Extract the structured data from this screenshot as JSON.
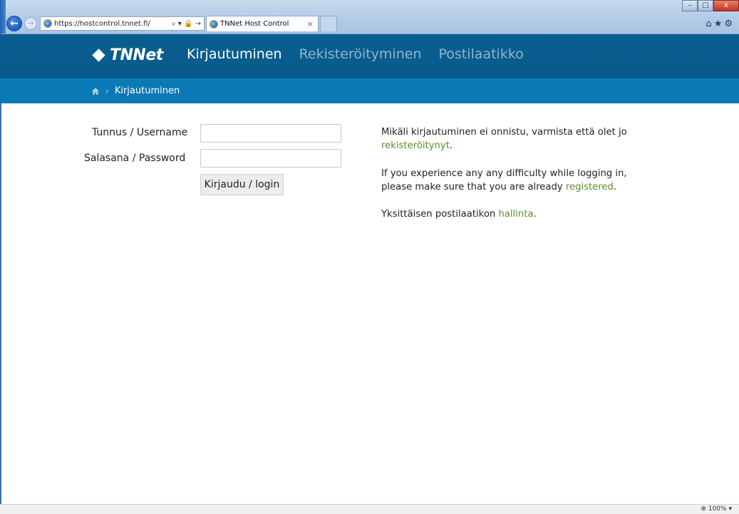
{
  "browser": {
    "url": "https://hostcontrol.tnnet.fi/",
    "address_controls": "⌕ ▾ 🔒 →",
    "tab_title": "TNNet Host Control",
    "tab_close": "×",
    "zoom": "100%"
  },
  "site": {
    "logo_text": "TNNet",
    "nav": [
      {
        "label": "Kirjautuminen",
        "active": true
      },
      {
        "label": "Rekisteröityminen",
        "active": false
      },
      {
        "label": "Postilaatikko",
        "active": false
      }
    ]
  },
  "breadcrumb": {
    "current": "Kirjautuminen"
  },
  "login_form": {
    "username_label": "Tunnus / Username",
    "password_label": "Salasana / Password",
    "username_value": "",
    "password_value": "",
    "submit_label": "Kirjaudu / login"
  },
  "info": {
    "p1_text": "Mikäli kirjautuminen ei onnistu, varmista että olet jo",
    "p1_link": "rekisteröitynyt",
    "p1_end": ".",
    "p2_text": "If you experience any any difficulty while logging in, please make sure that you are already",
    "p2_link": "registered",
    "p2_end": ".",
    "p3_text": "Yksittäisen postilaatikon",
    "p3_link": "hallinta",
    "p3_end": "."
  },
  "colors": {
    "header_bg": "#085a8a",
    "breadcrumb_bg": "#0a7ab5",
    "link": "#5a8f2b"
  }
}
